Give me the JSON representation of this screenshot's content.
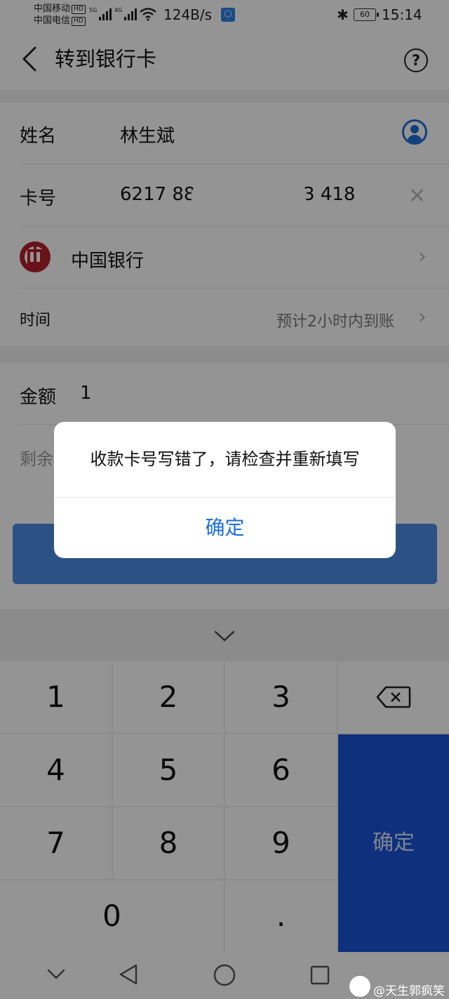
{
  "status_bar": {
    "carrier1": "中国移动",
    "carrier2": "中国电信",
    "hd": "HD",
    "net1": "5G",
    "net2": "4G",
    "speed": "124B/s",
    "battery": "60",
    "time": "15:14"
  },
  "header": {
    "title": "转到银行卡"
  },
  "form": {
    "name_label": "姓名",
    "name_value": "林生斌",
    "card_label": "卡号",
    "card_prefix": "6217 88",
    "card_suffix": "3 418",
    "bank_name": "中国银行",
    "time_label": "时间",
    "time_value": "预计2小时内到账",
    "amount_label": "金额",
    "amount_value": "1",
    "balance_label": "剩余"
  },
  "keypad": {
    "keys": [
      "1",
      "2",
      "3",
      "4",
      "5",
      "6",
      "7",
      "8",
      "9",
      "0",
      "."
    ],
    "confirm": "确定"
  },
  "dialog": {
    "message": "收款卡号写错了，请检查并重新填写",
    "button": "确定"
  },
  "watermark": "@天生郭疯笑",
  "colors": {
    "accent": "#1d6fd6",
    "keypad_confirm": "#1a53d6",
    "bank_red": "#b5202b"
  }
}
